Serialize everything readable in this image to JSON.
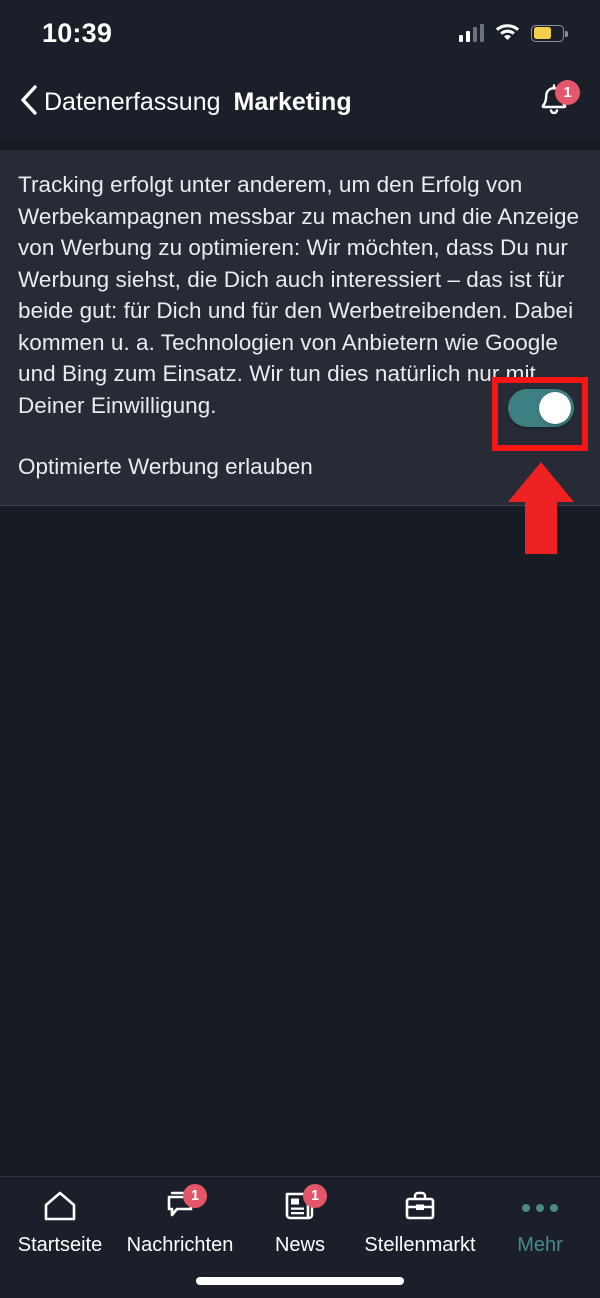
{
  "status_bar": {
    "time": "10:39",
    "signal_icon": "cellular-signal-icon",
    "signal_bars_total": 4,
    "signal_bars_filled": 2,
    "wifi_icon": "wifi-icon",
    "battery_icon": "battery-icon",
    "battery_level_percent": 62,
    "battery_color": "#f2d04b"
  },
  "header": {
    "back_icon": "chevron-left-icon",
    "back_label": "Datenerfassung",
    "title": "Marketing",
    "bell_icon": "bell-icon",
    "bell_badge": "1",
    "badge_color": "#e5566a"
  },
  "card": {
    "body_text": "Tracking erfolgt unter anderem, um den Erfolg von Werbekampagnen messbar zu machen und die Anzeige von Werbung zu optimieren: Wir möchten, dass Du nur Werbung siehst, die Dich auch interessiert – das ist für beide gut: für Dich und für den Werbetreibenden. Dabei kommen u. a. Technologien von Anbietern wie Google und Bing zum Einsatz. Wir tun dies natürlich nur mit Deiner Einwilligung.",
    "toggle_label": "Optimierte Werbung erlauben",
    "toggle_state": "on",
    "toggle_on_color": "#3d8083",
    "toggle_knob_color": "#ffffff"
  },
  "annotation": {
    "highlight_color": "#f81515",
    "highlight_target": "toggle-switch",
    "arrow_icon": "arrow-up-icon",
    "arrow_color": "#ee2222"
  },
  "bottom_nav": {
    "items": [
      {
        "label": "Startseite",
        "icon": "home-icon",
        "badge": "",
        "active": false
      },
      {
        "label": "Nachrichten",
        "icon": "chat-bubbles-icon",
        "badge": "1",
        "active": false
      },
      {
        "label": "News",
        "icon": "newspaper-icon",
        "badge": "1",
        "active": false
      },
      {
        "label": "Stellenmarkt",
        "icon": "briefcase-icon",
        "badge": "",
        "active": false
      },
      {
        "label": "Mehr",
        "icon": "ellipsis-icon",
        "badge": "",
        "active": true
      }
    ],
    "active_color": "#49898c",
    "home_indicator": "home-indicator"
  }
}
